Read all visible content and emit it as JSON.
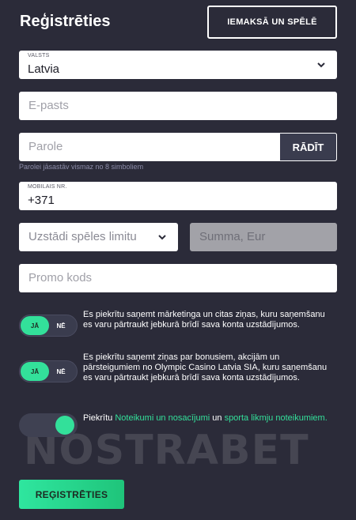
{
  "header": {
    "title": "Reģistrēties",
    "deposit_label": "IEMAKSĀ UN SPĒLĒ"
  },
  "form": {
    "country": {
      "label": "VALSTS",
      "value": "Latvia"
    },
    "email": {
      "placeholder": "E-pasts"
    },
    "password": {
      "placeholder": "Parole",
      "show_label": "RĀDĪT",
      "hint": "Parolei jāsastāv vismaz no 8 simboliem"
    },
    "phone": {
      "label": "MOBILAIS NR.",
      "value": "+371"
    },
    "limit": {
      "placeholder": "Uzstādi spēles limitu"
    },
    "amount": {
      "placeholder": "Summa, Eur"
    },
    "promo": {
      "placeholder": "Promo kods"
    }
  },
  "consents": [
    {
      "on_label": "JĀ",
      "off_label": "NĒ",
      "text": "Es piekrītu saņemt mārketinga un citas ziņas, kuru saņemšanu es varu pārtraukt jebkurā brīdī sava konta uzstādījumos."
    },
    {
      "on_label": "JĀ",
      "off_label": "NĒ",
      "text": "Es piekrītu saņemt ziņas par bonusiem, akcijām un pārsteigumiem no Olympic Casino Latvia SIA, kuru saņemšanu es varu pārtraukt jebkurā brīdī sava konta uzstādījumos."
    }
  ],
  "terms": {
    "prefix": "Piekrītu ",
    "link1": "Noteikumi un nosacījumi",
    "middle": " un ",
    "link2": "sporta likmju noteikumiem",
    "suffix": "."
  },
  "watermark": "NOSTRABET",
  "register_label": "REĢISTRĒTIES",
  "icons": [
    "chevron-down-icon"
  ],
  "colors": {
    "background": "#2b2b39",
    "accent": "#33e09a"
  }
}
